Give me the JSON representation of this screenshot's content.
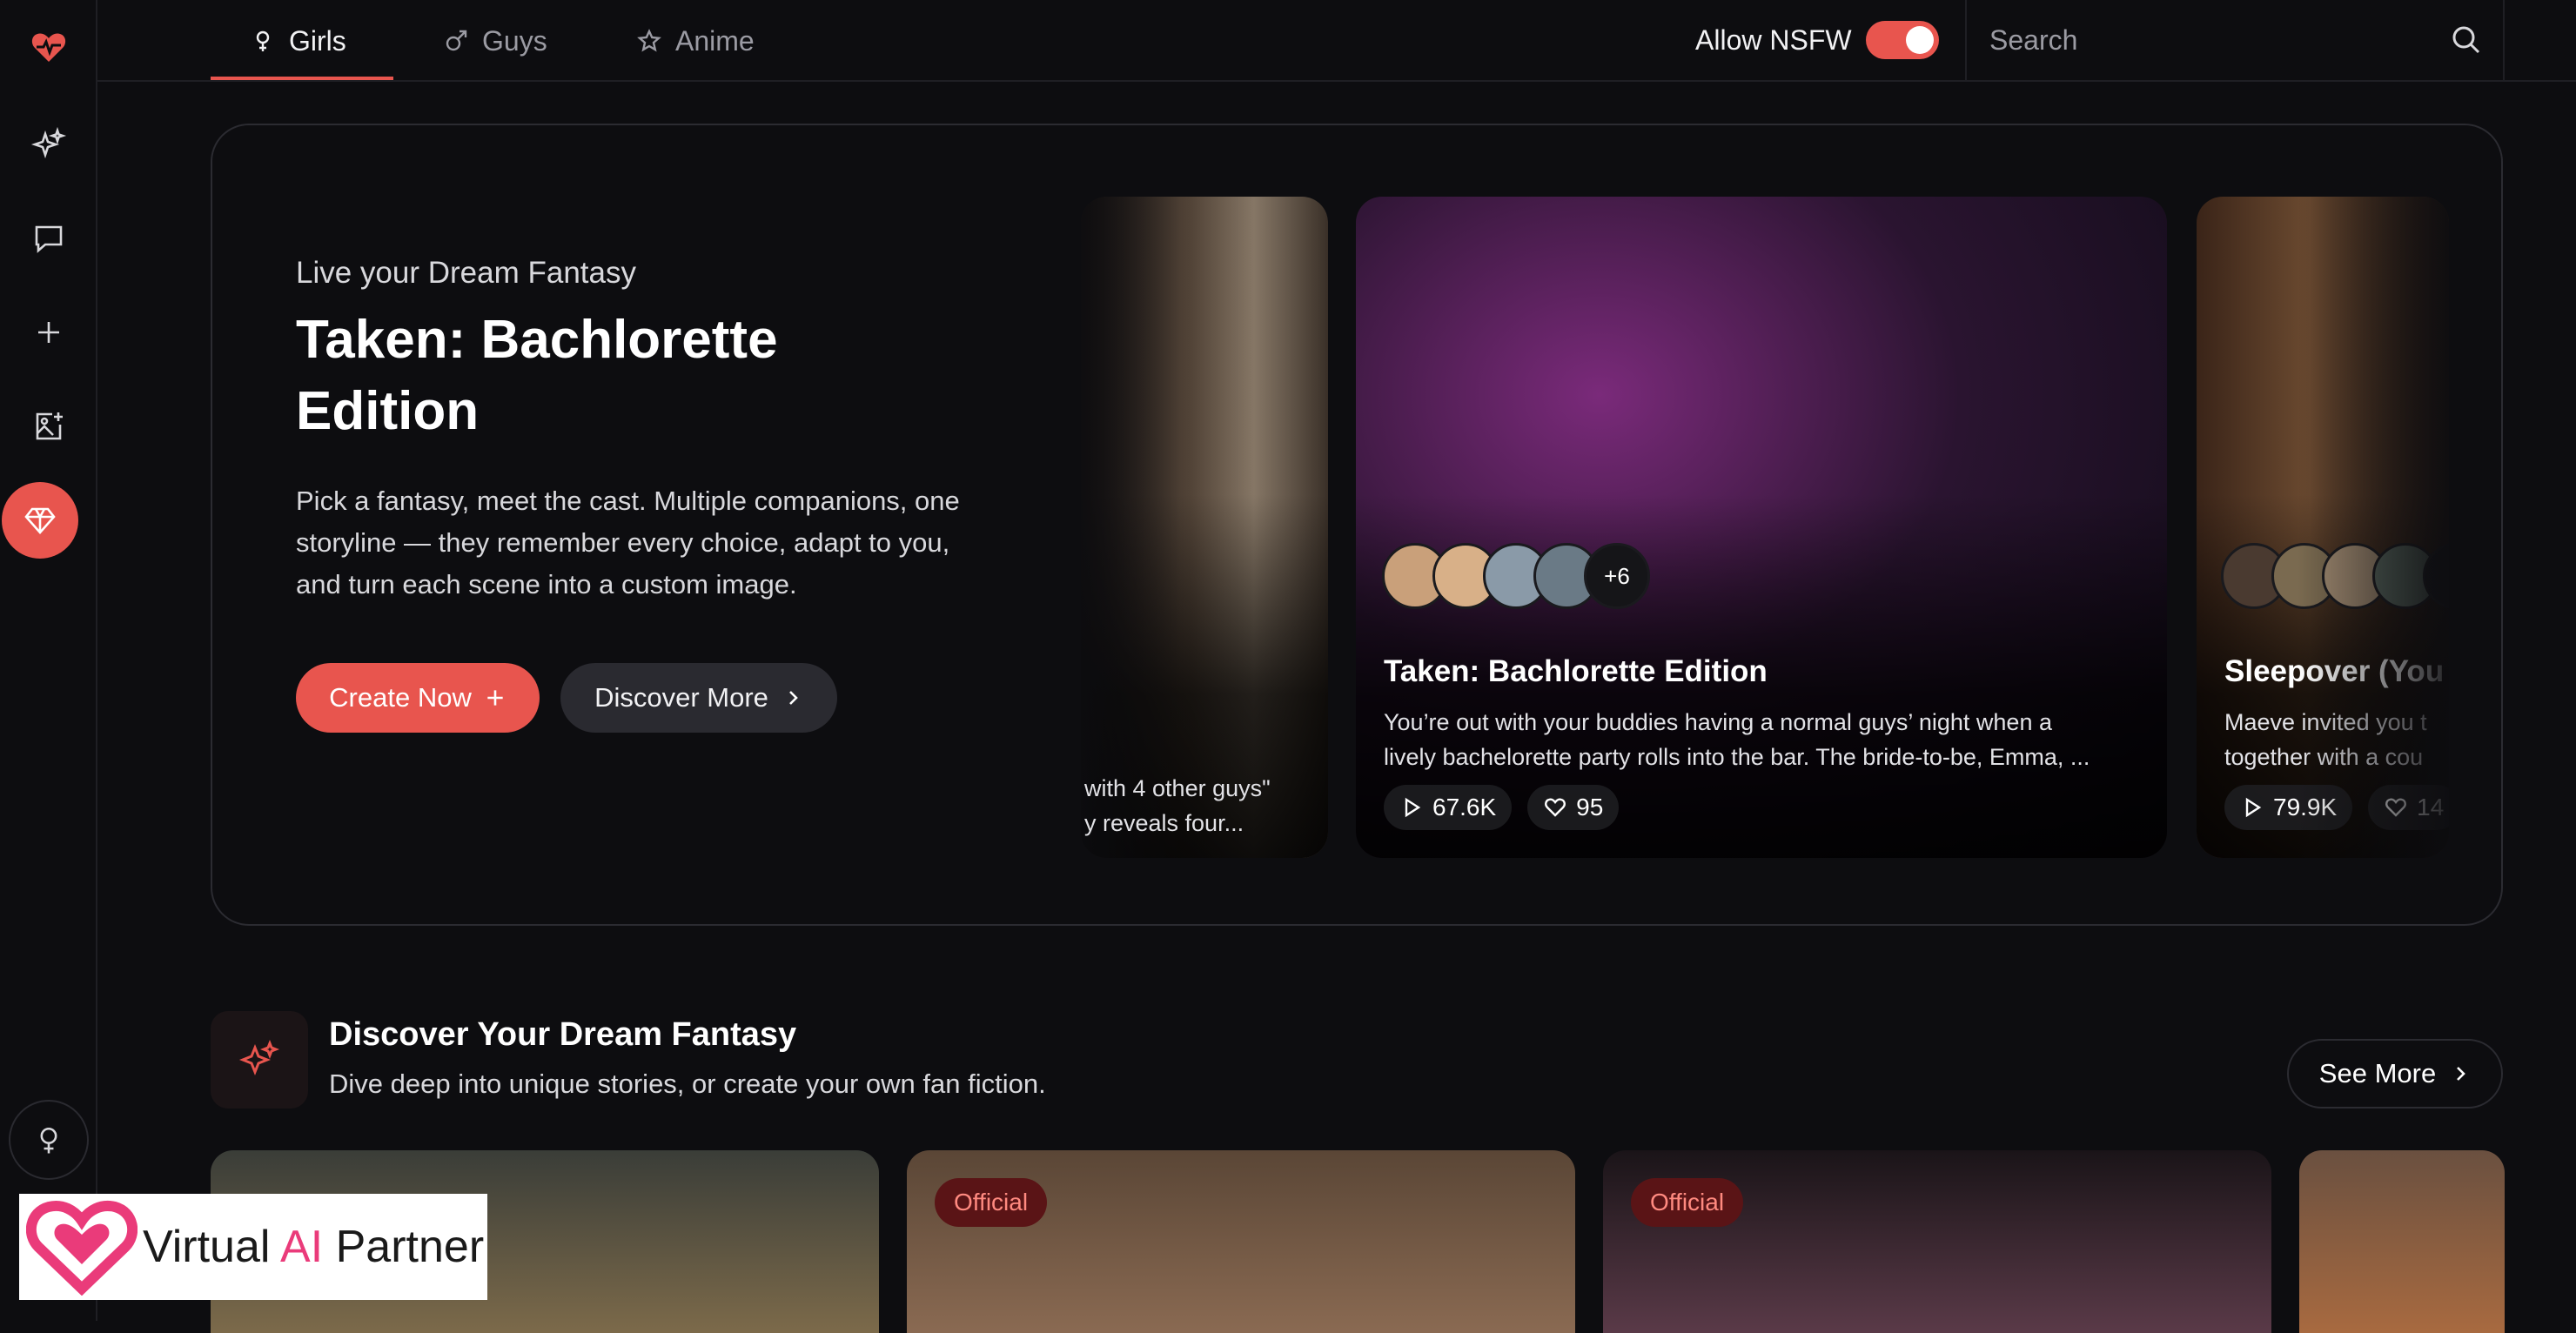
{
  "nav": {
    "tabs": [
      {
        "label": "Girls"
      },
      {
        "label": "Guys"
      },
      {
        "label": "Anime"
      }
    ],
    "nsfw_label": "Allow NSFW",
    "nsfw_on": true,
    "search_placeholder": "Search"
  },
  "sidebar": {
    "items": [
      "logo-heart-icon",
      "sparkles-icon",
      "chat-icon",
      "plus-icon",
      "image-plus-icon",
      "gem-icon",
      "female-icon"
    ]
  },
  "hero": {
    "eyebrow": "Live your Dream Fantasy",
    "title": "Taken: Bachlorette Edition",
    "description": "Pick a fantasy, meet the cast. Multiple companions, one storyline — they remember every choice, adapt to you, and turn each scene into a custom image.",
    "create_label": "Create Now",
    "discover_label": "Discover More",
    "left_card": {
      "desc_line1": "with 4 other guys\"",
      "desc_line2": "y reveals four..."
    },
    "main_card": {
      "more_count": "+6",
      "title": "Taken: Bachlorette Edition",
      "desc_line1": "You’re out with your buddies having a normal guys’ night when a",
      "desc_line2": "lively bachelorette party rolls into the bar. The bride-to-be, Emma, ...",
      "plays": "67.6K",
      "likes": "95"
    },
    "right_card": {
      "more_count": "+",
      "title": "Sleepover (You",
      "desc_line1": "Maeve invited you t",
      "desc_line2": "together with a cou",
      "plays": "79.9K",
      "likes": "14"
    }
  },
  "discover": {
    "title": "Discover Your Dream Fantasy",
    "subtitle": "Dive deep into unique stories, or create your own fan fiction.",
    "see_more_label": "See More",
    "tiles": [
      {
        "badge": ""
      },
      {
        "badge": "Official"
      },
      {
        "badge": "Official"
      },
      {
        "badge": ""
      }
    ]
  },
  "watermark": {
    "text_pre": "Virtual ",
    "text_ai": "AI",
    "text_post": " Partner"
  },
  "colors": {
    "accent": "#e8554e",
    "background": "#0d0d10",
    "brand_pink": "#ea3b7a"
  }
}
